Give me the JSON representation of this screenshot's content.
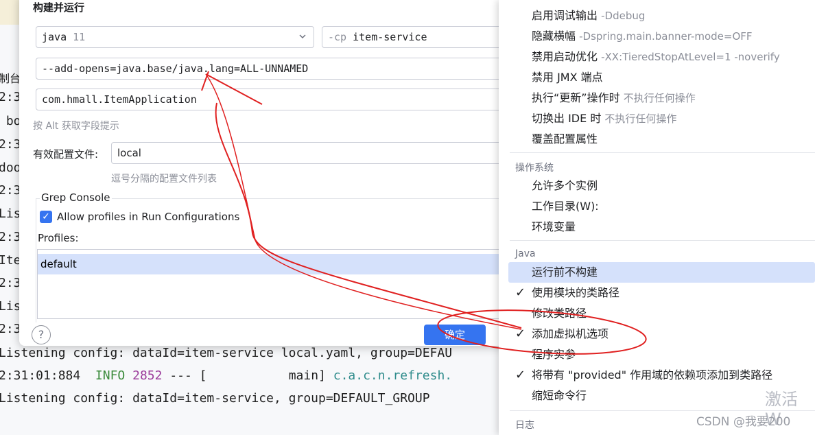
{
  "console": {
    "lines": [
      {
        "text": "制台"
      },
      {
        "text": "2:3"
      },
      {
        "text": " bo"
      },
      {
        "text": "2:3"
      },
      {
        "text": "doo"
      },
      {
        "text": "2:3"
      },
      {
        "text": "Lis"
      },
      {
        "text": "2:3"
      },
      {
        "text": "Ite"
      },
      {
        "text": "2:3"
      },
      {
        "text": "Lis"
      },
      {
        "text": "2:3"
      },
      {
        "text": "Listening config: dataId=item-service local.yaml, group=DEFAU"
      }
    ],
    "log_time": "2:31:01:884",
    "log_level": "INFO",
    "log_pid": "2852",
    "log_sep": "--- [",
    "log_thread": "main]",
    "log_class": "c.a.c.n.refresh.",
    "last_line": "Listening config: dataId=item-service, group=DEFAULT_GROUP"
  },
  "dialog": {
    "title": "构建并运行",
    "jdk_keyword": "java",
    "jdk_version": "11",
    "cp_flag": "-cp",
    "cp_module": "item-service",
    "vm_options": "--add-opens=java.base/java.lang=ALL-UNNAMED",
    "main_class": "com.hmall.ItemApplication",
    "alt_hint": "按 Alt 获取字段提示",
    "profiles_label": "有效配置文件:",
    "profiles_value": "local",
    "profiles_hint": "逗号分隔的配置文件列表",
    "grep_title": "Grep Console",
    "allow_profiles": "Allow profiles in Run Configurations",
    "profiles_list_label": "Profiles:",
    "profiles_list_item": "default",
    "help": "?",
    "ok": "确定"
  },
  "popup": {
    "items_top": [
      {
        "label": "启用调试输出",
        "sub": "-Ddebug"
      },
      {
        "label": "隐藏横幅",
        "sub": "-Dspring.main.banner-mode=OFF"
      },
      {
        "label": "禁用启动优化",
        "sub": "-XX:TieredStopAtLevel=1 -noverify"
      },
      {
        "label": "禁用 JMX 端点",
        "sub": ""
      },
      {
        "label": "执行“更新”操作时",
        "sub": "不执行任何操作"
      },
      {
        "label": "切换出 IDE 时",
        "sub": "不执行任何操作"
      },
      {
        "label": "覆盖配置属性",
        "sub": ""
      }
    ],
    "section_os": "操作系统",
    "items_os": [
      {
        "label": "允许多个实例"
      },
      {
        "label": "工作目录(W):"
      },
      {
        "label": "环境变量"
      }
    ],
    "section_java": "Java",
    "items_java": [
      {
        "label": "运行前不构建",
        "checked": false
      },
      {
        "label": "使用模块的类路径",
        "checked": true
      },
      {
        "label": "修改类路径",
        "checked": false
      },
      {
        "label": "添加虚拟机选项",
        "checked": true
      },
      {
        "label": "程序实参",
        "checked": false
      },
      {
        "label": "将带有 \"provided\" 作用域的依赖项添加到类路径",
        "checked": true
      },
      {
        "label": "缩短命令行",
        "checked": false
      }
    ],
    "section_log": "日志",
    "checkmark": "✓",
    "watermark": "激活 W",
    "credit": "CSDN @我要200"
  }
}
